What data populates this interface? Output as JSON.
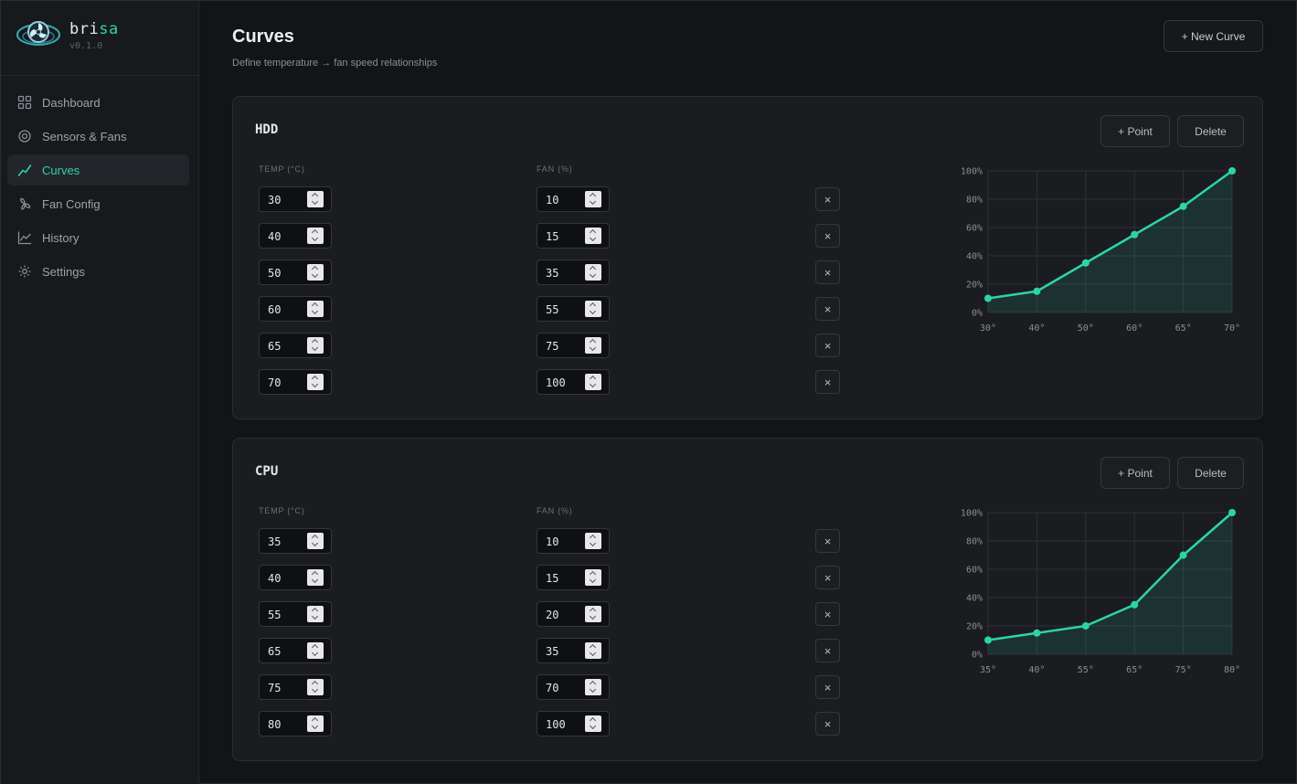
{
  "brand": {
    "name_plain": "bri",
    "name_accent": "sa",
    "version": "v0.1.0"
  },
  "nav": {
    "items": [
      {
        "label": "Dashboard",
        "icon": "grid-icon",
        "active": false
      },
      {
        "label": "Sensors & Fans",
        "icon": "target-icon",
        "active": false
      },
      {
        "label": "Curves",
        "icon": "trend-icon",
        "active": true
      },
      {
        "label": "Fan Config",
        "icon": "fan-icon",
        "active": false
      },
      {
        "label": "History",
        "icon": "chart-line-icon",
        "active": false
      },
      {
        "label": "Settings",
        "icon": "gear-icon",
        "active": false
      }
    ]
  },
  "page": {
    "title": "Curves",
    "subtitle": "Define temperature → fan speed relationships",
    "new_curve_label": "+ New Curve"
  },
  "labels": {
    "temp_header": "TEMP (°C)",
    "fan_header": "FAN (%)",
    "add_point": "+ Point",
    "delete": "Delete",
    "remove_row": "×"
  },
  "colors": {
    "accent": "#2dd4a7",
    "background": "#131417",
    "card": "#1b1c20"
  },
  "curves": [
    {
      "name": "HDD",
      "points": [
        {
          "temp": "30",
          "fan": "10"
        },
        {
          "temp": "40",
          "fan": "15"
        },
        {
          "temp": "50",
          "fan": "35"
        },
        {
          "temp": "60",
          "fan": "55"
        },
        {
          "temp": "65",
          "fan": "75"
        },
        {
          "temp": "70",
          "fan": "100"
        }
      ]
    },
    {
      "name": "CPU",
      "points": [
        {
          "temp": "35",
          "fan": "10"
        },
        {
          "temp": "40",
          "fan": "15"
        },
        {
          "temp": "55",
          "fan": "20"
        },
        {
          "temp": "65",
          "fan": "35"
        },
        {
          "temp": "75",
          "fan": "70"
        },
        {
          "temp": "80",
          "fan": "100"
        }
      ]
    }
  ],
  "chart_data": [
    {
      "type": "area",
      "x": [
        30,
        40,
        50,
        60,
        65,
        70
      ],
      "values": [
        10,
        15,
        35,
        55,
        75,
        100
      ],
      "x_tick_labels": [
        "30°",
        "40°",
        "50°",
        "60°",
        "65°",
        "70°"
      ],
      "y_tick_labels": [
        "100%",
        "80%",
        "60%",
        "40%",
        "20%",
        "0%"
      ],
      "ylim": [
        0,
        100
      ],
      "grid": true
    },
    {
      "type": "area",
      "x": [
        35,
        40,
        55,
        65,
        75,
        80
      ],
      "values": [
        10,
        15,
        20,
        35,
        70,
        100
      ],
      "x_tick_labels": [
        "35°",
        "40°",
        "55°",
        "65°",
        "75°",
        "80°"
      ],
      "y_tick_labels": [
        "100%",
        "80%",
        "60%",
        "40%",
        "20%",
        "0%"
      ],
      "ylim": [
        0,
        100
      ],
      "grid": true
    }
  ]
}
